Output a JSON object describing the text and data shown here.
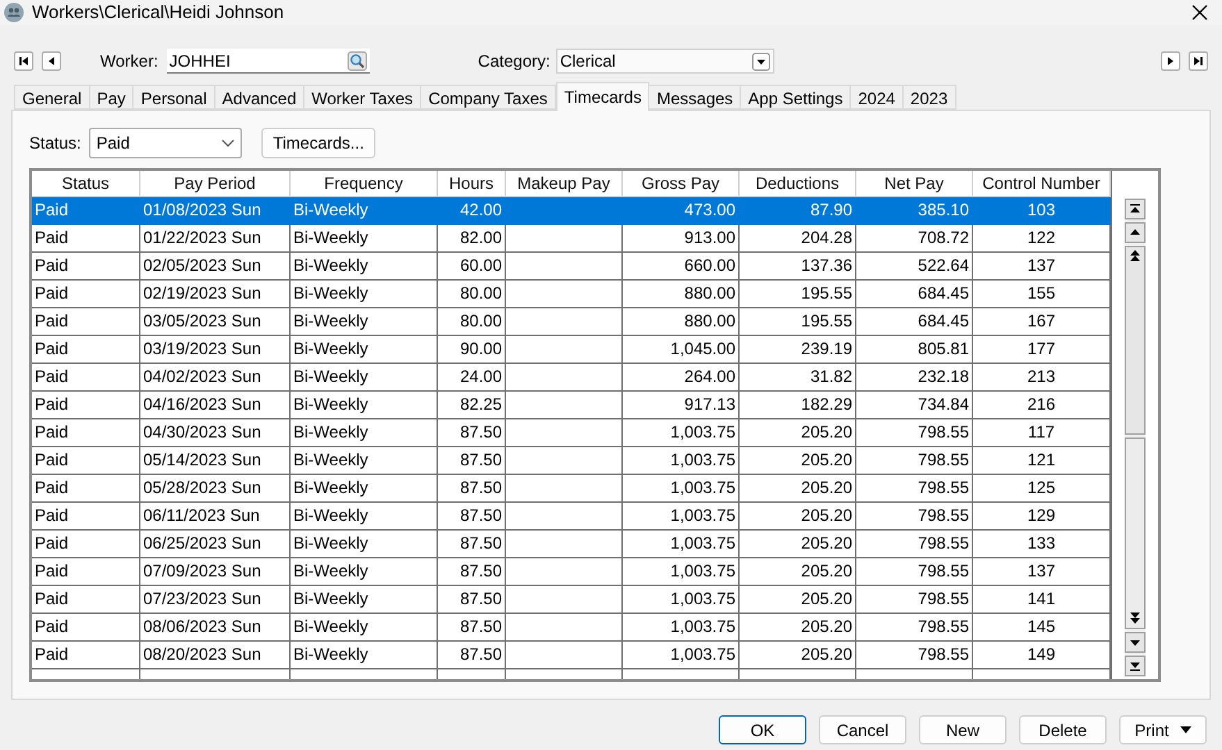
{
  "window": {
    "title": "Workers\\Clerical\\Heidi Johnson"
  },
  "worker": {
    "label": "Worker:",
    "value": "JOHHEI"
  },
  "category": {
    "label": "Category:",
    "value": "Clerical"
  },
  "tabs": [
    {
      "label": "General",
      "selected": false
    },
    {
      "label": "Pay",
      "selected": false
    },
    {
      "label": "Personal",
      "selected": false
    },
    {
      "label": "Advanced",
      "selected": false
    },
    {
      "label": "Worker Taxes",
      "selected": false
    },
    {
      "label": "Company Taxes",
      "selected": false
    },
    {
      "label": "Timecards",
      "selected": true
    },
    {
      "label": "Messages",
      "selected": false
    },
    {
      "label": "App Settings",
      "selected": false
    },
    {
      "label": "2024",
      "selected": false
    },
    {
      "label": "2023",
      "selected": false
    }
  ],
  "status_filter": {
    "label": "Status:",
    "value": "Paid"
  },
  "timecards_button": "Timecards...",
  "table": {
    "columns": [
      "Status",
      "Pay Period",
      "Frequency",
      "Hours",
      "Makeup Pay",
      "Gross Pay",
      "Deductions",
      "Net Pay",
      "Control Number"
    ],
    "rows": [
      {
        "selected": true,
        "cells": [
          "Paid",
          "01/08/2023 Sun",
          "Bi-Weekly",
          "42.00",
          "",
          "473.00",
          "87.90",
          "385.10",
          "103"
        ]
      },
      {
        "selected": false,
        "cells": [
          "Paid",
          "01/22/2023 Sun",
          "Bi-Weekly",
          "82.00",
          "",
          "913.00",
          "204.28",
          "708.72",
          "122"
        ]
      },
      {
        "selected": false,
        "cells": [
          "Paid",
          "02/05/2023 Sun",
          "Bi-Weekly",
          "60.00",
          "",
          "660.00",
          "137.36",
          "522.64",
          "137"
        ]
      },
      {
        "selected": false,
        "cells": [
          "Paid",
          "02/19/2023 Sun",
          "Bi-Weekly",
          "80.00",
          "",
          "880.00",
          "195.55",
          "684.45",
          "155"
        ]
      },
      {
        "selected": false,
        "cells": [
          "Paid",
          "03/05/2023 Sun",
          "Bi-Weekly",
          "80.00",
          "",
          "880.00",
          "195.55",
          "684.45",
          "167"
        ]
      },
      {
        "selected": false,
        "cells": [
          "Paid",
          "03/19/2023 Sun",
          "Bi-Weekly",
          "90.00",
          "",
          "1,045.00",
          "239.19",
          "805.81",
          "177"
        ]
      },
      {
        "selected": false,
        "cells": [
          "Paid",
          "04/02/2023 Sun",
          "Bi-Weekly",
          "24.00",
          "",
          "264.00",
          "31.82",
          "232.18",
          "213"
        ]
      },
      {
        "selected": false,
        "cells": [
          "Paid",
          "04/16/2023 Sun",
          "Bi-Weekly",
          "82.25",
          "",
          "917.13",
          "182.29",
          "734.84",
          "216"
        ]
      },
      {
        "selected": false,
        "cells": [
          "Paid",
          "04/30/2023 Sun",
          "Bi-Weekly",
          "87.50",
          "",
          "1,003.75",
          "205.20",
          "798.55",
          "117"
        ]
      },
      {
        "selected": false,
        "cells": [
          "Paid",
          "05/14/2023 Sun",
          "Bi-Weekly",
          "87.50",
          "",
          "1,003.75",
          "205.20",
          "798.55",
          "121"
        ]
      },
      {
        "selected": false,
        "cells": [
          "Paid",
          "05/28/2023 Sun",
          "Bi-Weekly",
          "87.50",
          "",
          "1,003.75",
          "205.20",
          "798.55",
          "125"
        ]
      },
      {
        "selected": false,
        "cells": [
          "Paid",
          "06/11/2023 Sun",
          "Bi-Weekly",
          "87.50",
          "",
          "1,003.75",
          "205.20",
          "798.55",
          "129"
        ]
      },
      {
        "selected": false,
        "cells": [
          "Paid",
          "06/25/2023 Sun",
          "Bi-Weekly",
          "87.50",
          "",
          "1,003.75",
          "205.20",
          "798.55",
          "133"
        ]
      },
      {
        "selected": false,
        "cells": [
          "Paid",
          "07/09/2023 Sun",
          "Bi-Weekly",
          "87.50",
          "",
          "1,003.75",
          "205.20",
          "798.55",
          "137"
        ]
      },
      {
        "selected": false,
        "cells": [
          "Paid",
          "07/23/2023 Sun",
          "Bi-Weekly",
          "87.50",
          "",
          "1,003.75",
          "205.20",
          "798.55",
          "141"
        ]
      },
      {
        "selected": false,
        "cells": [
          "Paid",
          "08/06/2023 Sun",
          "Bi-Weekly",
          "87.50",
          "",
          "1,003.75",
          "205.20",
          "798.55",
          "145"
        ]
      },
      {
        "selected": false,
        "cells": [
          "Paid",
          "08/20/2023 Sun",
          "Bi-Weekly",
          "87.50",
          "",
          "1,003.75",
          "205.20",
          "798.55",
          "149"
        ]
      }
    ]
  },
  "buttons": [
    {
      "label": "OK",
      "kind": "default"
    },
    {
      "label": "Cancel",
      "kind": "plain"
    },
    {
      "label": "New",
      "kind": "plain"
    },
    {
      "label": "Delete",
      "kind": "plain"
    },
    {
      "label": "Print",
      "kind": "menu"
    }
  ]
}
